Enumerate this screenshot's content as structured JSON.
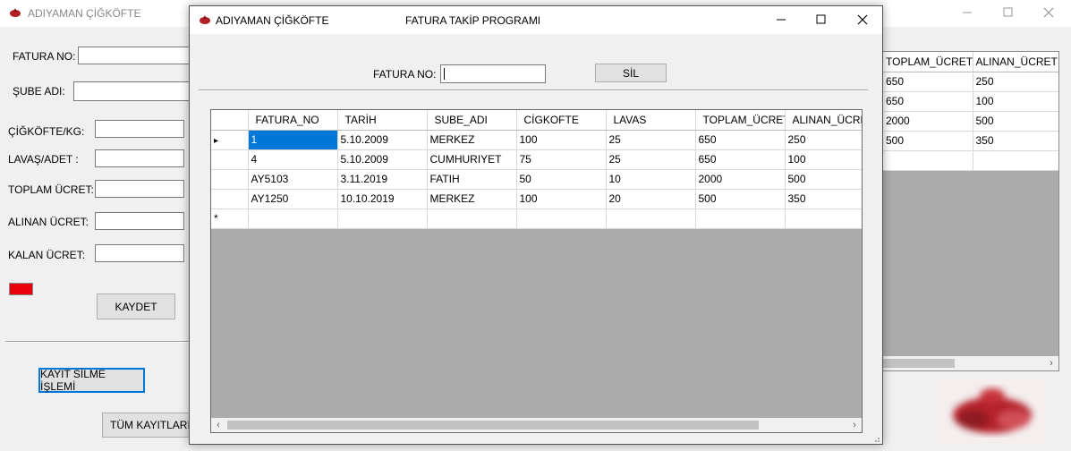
{
  "bg": {
    "title": "ADIYAMAN ÇİĞKÖFTE",
    "fatura_no_label": "FATURA NO:",
    "sube_adi_label": "ŞUBE ADI:",
    "cigkofte_label": "ÇİĞKÖFTE/KG:",
    "lavas_label": "LAVAŞ/ADET :",
    "toplam_label": "TOPLAM ÜCRET:",
    "alinan_label": "ALINAN ÜCRET:",
    "kalan_label": "KALAN ÜCRET:",
    "kaydet_label": "KAYDET",
    "kayit_silme_label": "KAYIT SİLME İŞLEMİ",
    "tum_kayitlar_label": "TÜM KAYITLARI G",
    "indicator_color": "#e8000d",
    "grid_headers": [
      "TOPLAM_ÜCRET",
      "ALINAN_ÜCRET"
    ],
    "grid_rows": [
      [
        "650",
        "250"
      ],
      [
        "650",
        "100"
      ],
      [
        "2000",
        "500"
      ],
      [
        "500",
        "350"
      ],
      [
        "",
        ""
      ]
    ]
  },
  "dialog": {
    "app_name": "ADIYAMAN ÇİĞKÖFTE",
    "title": "FATURA TAKİP PROGRAMI",
    "fatura_no_label": "FATURA NO:",
    "fatura_no_value": "",
    "sil_label": "SİL",
    "grid_headers": [
      "FATURA_NO",
      "TARİH",
      "SUBE_ADI",
      "CİGKOFTE",
      "LAVAS",
      "TOPLAM_ÜCRET",
      "ALINAN_ÜCRET"
    ],
    "grid_rows": [
      [
        "1",
        "5.10.2009",
        "MERKEZ",
        "100",
        "25",
        "650",
        "250"
      ],
      [
        "4",
        "5.10.2009",
        "CUMHURIYET",
        "75",
        "25",
        "650",
        "100"
      ],
      [
        "AY5103",
        "3.11.2019",
        "FATIH",
        "50",
        "10",
        "2000",
        "500"
      ],
      [
        "AY1250",
        "10.10.2019",
        "MERKEZ",
        "100",
        "20",
        "500",
        "350"
      ]
    ],
    "new_row_marker": "*",
    "current_row_marker": "▸",
    "selection_color": "#0078d7"
  }
}
